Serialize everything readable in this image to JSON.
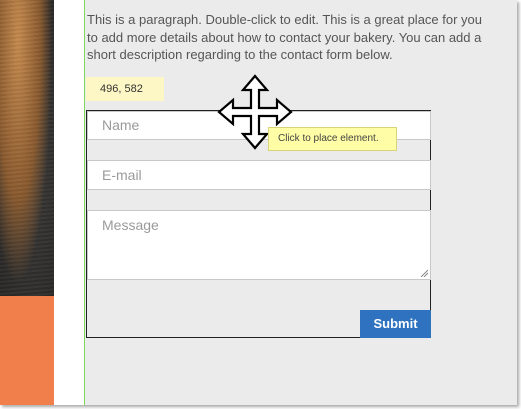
{
  "paragraph": {
    "line1": "This is a paragraph. Double-click to edit. This is a great place for you",
    "line2": "to add more details about how to contact your bakery. You can add a",
    "line3": "short description regarding to the contact form below."
  },
  "position_readout": "496, 582",
  "form": {
    "name_placeholder": "Name",
    "email_placeholder": "E-mail",
    "message_placeholder": "Message",
    "submit_label": "Submit"
  },
  "tooltip": "Click to place element.",
  "icons": {
    "cursor": "move-cursor-icon",
    "resize": "resize-grip-icon"
  },
  "colors": {
    "accent_button": "#2e72c0",
    "guide_line": "#7ed957",
    "orange_block": "#f07f4c",
    "tooltip_bg": "#fffda6",
    "readout_bg": "#fdf7c5"
  }
}
